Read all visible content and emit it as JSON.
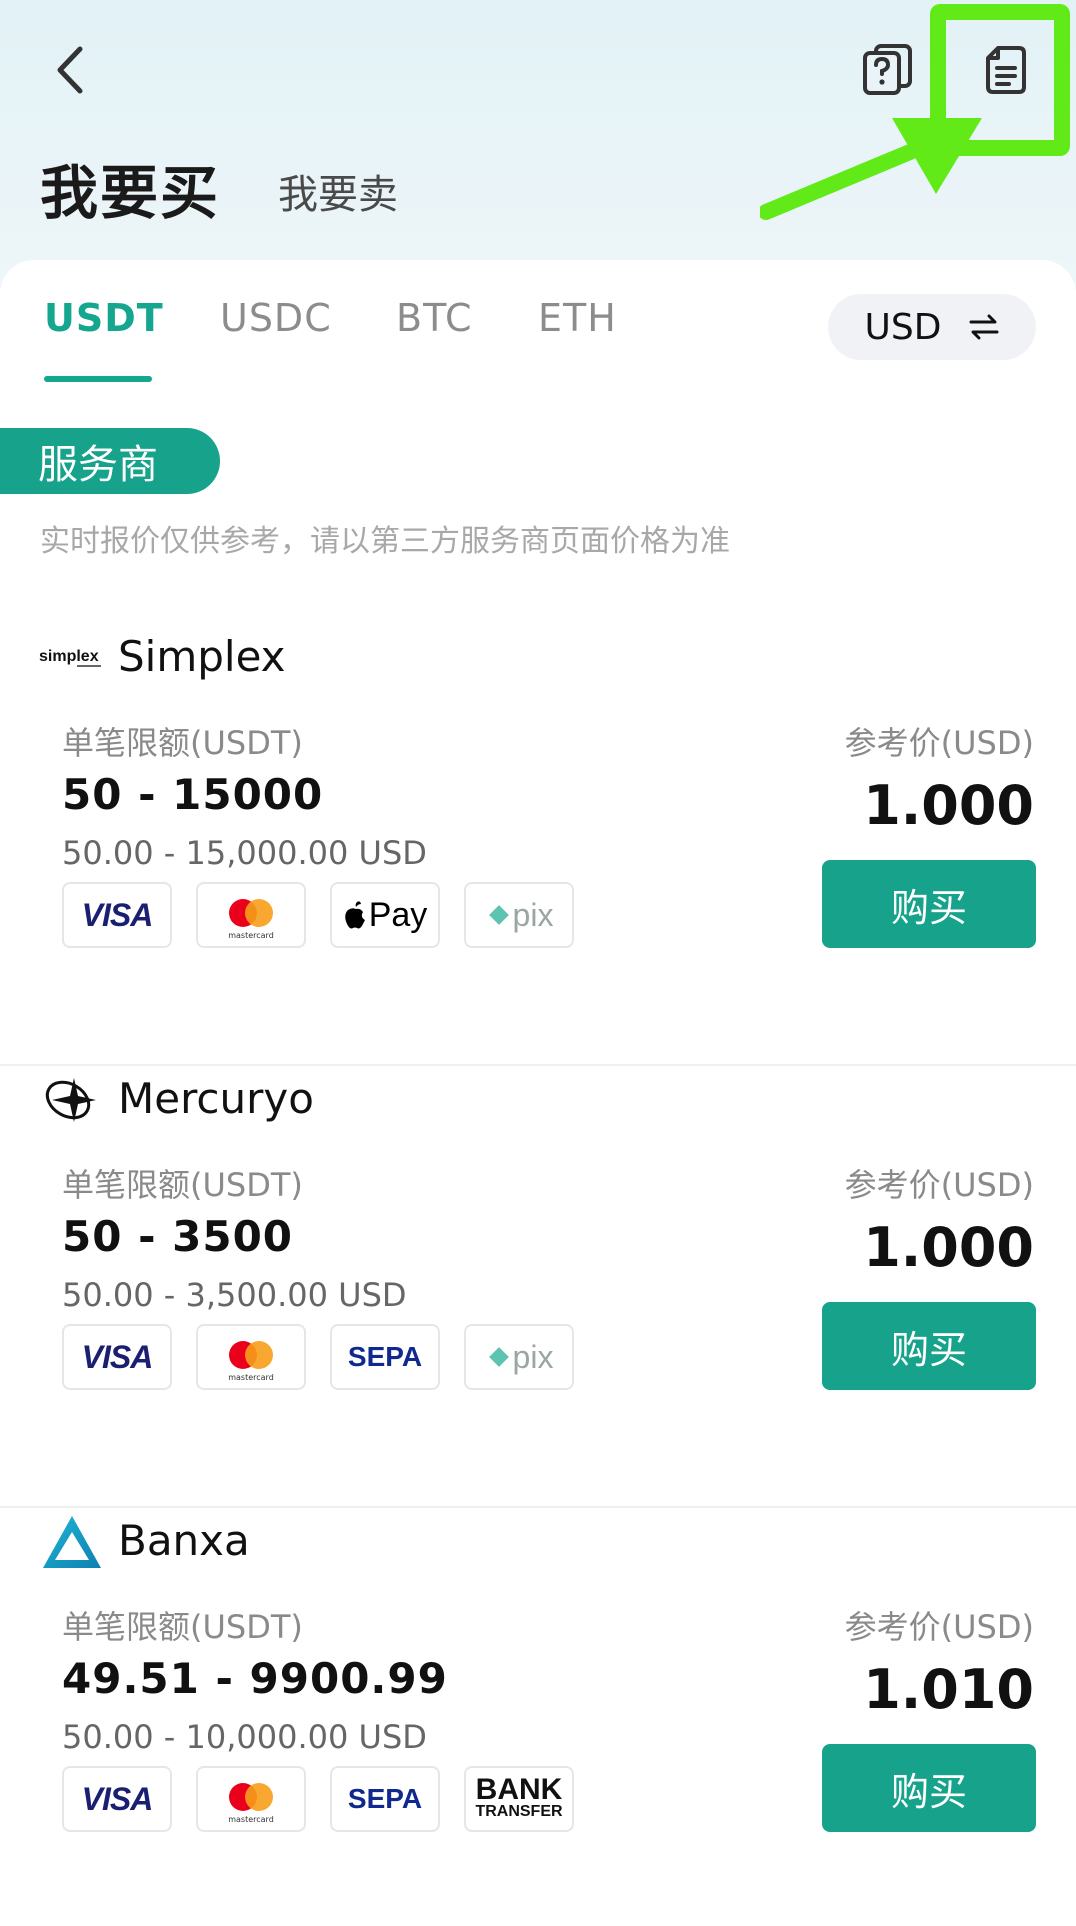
{
  "header": {
    "title_buy": "我要买",
    "title_sell": "我要卖"
  },
  "tabs": [
    {
      "label": "USDT",
      "active": true
    },
    {
      "label": "USDC",
      "active": false
    },
    {
      "label": "BTC",
      "active": false
    },
    {
      "label": "ETH",
      "active": false
    }
  ],
  "fiat": {
    "label": "USD"
  },
  "section": {
    "title": "服务商",
    "disclaimer": "实时报价仅供参考，请以第三方服务商页面价格为准"
  },
  "providers": [
    {
      "name": "Simplex",
      "logo_text": "simplex",
      "limit_label": "单笔限额(USDT)",
      "limit_range": "50  -  15000",
      "limit_usd": "50.00 - 15,000.00 USD",
      "ref_label": "参考价(USD)",
      "ref_price": "1.000",
      "buy_label": "购买",
      "methods": [
        "visa",
        "mastercard",
        "apple-pay",
        "pix"
      ]
    },
    {
      "name": "Mercuryo",
      "limit_label": "单笔限额(USDT)",
      "limit_range": "50  -  3500",
      "limit_usd": "50.00 - 3,500.00 USD",
      "ref_label": "参考价(USD)",
      "ref_price": "1.000",
      "buy_label": "购买",
      "methods": [
        "visa",
        "mastercard",
        "sepa",
        "pix"
      ]
    },
    {
      "name": "Banxa",
      "limit_label": "单笔限额(USDT)",
      "limit_range": "49.51  -  9900.99",
      "limit_usd": "50.00 - 10,000.00 USD",
      "ref_label": "参考价(USD)",
      "ref_price": "1.010",
      "buy_label": "购买",
      "methods": [
        "visa",
        "mastercard",
        "sepa",
        "bank-transfer"
      ]
    }
  ],
  "payment_labels": {
    "visa": "VISA",
    "mastercard": "mastercard",
    "apple_pay": "Pay",
    "pix": "pix",
    "sepa": "SEPA",
    "bank": "BANK",
    "transfer": "TRANSFER"
  },
  "colors": {
    "accent": "#16a28b",
    "annotation": "#62ea18"
  },
  "icons": {
    "back": "chevron-left-icon",
    "help": "help-document-icon",
    "orders": "orders-document-icon"
  }
}
